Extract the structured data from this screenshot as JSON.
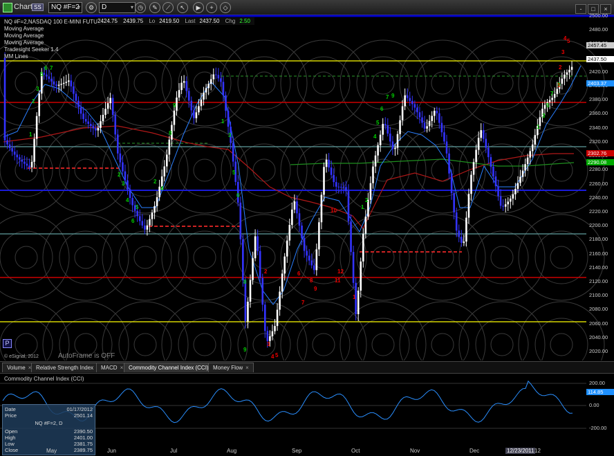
{
  "window": {
    "title": "Chart",
    "badge": "SS",
    "symbol_input": "NQ #F=2",
    "interval_input": "D",
    "controls": [
      "-",
      "□",
      "×"
    ]
  },
  "quote": {
    "open": "2424.75",
    "high": "2439.75",
    "lo_label": "Lo",
    "low": "2419.50",
    "last_label": "Last",
    "last": "2437.50",
    "chg_label": "Chg",
    "chg": "2.50"
  },
  "studies": {
    "header": "NQ #F=2,NASDAQ 100 E-MINI FUTURES",
    "items": [
      "Moving Average",
      "Moving Average",
      "Moving Average",
      "Tradesight Seeker 1.4",
      "MM Lines"
    ]
  },
  "watermark": {
    "esignal": "© eSignal, 2012",
    "autoframe": "AutoFrame is OFF",
    "p_button": "P"
  },
  "price_axis": {
    "ticks": [
      "2500.00",
      "2480.00",
      "2460.00",
      "2440.00",
      "2420.00",
      "2400.00",
      "2380.00",
      "2360.00",
      "2340.00",
      "2320.00",
      "2300.00",
      "2280.00",
      "2260.00",
      "2240.00",
      "2220.00",
      "2200.00",
      "2180.00",
      "2160.00",
      "2140.00",
      "2120.00",
      "2100.00",
      "2080.00",
      "2060.00",
      "2040.00",
      "2020.00"
    ],
    "tags": [
      {
        "text": "2457.45",
        "bg": "#cccccc",
        "fg": "#000000"
      },
      {
        "text": "2437.50",
        "bg": "#ffffff",
        "fg": "#000000"
      },
      {
        "text": "2403.37",
        "bg": "#1e90ff",
        "fg": "#ffffff"
      },
      {
        "text": "2302.76",
        "bg": "#cc0000",
        "fg": "#ffffff"
      },
      {
        "text": "2290.08",
        "bg": "#00aa00",
        "fg": "#ffffff"
      }
    ]
  },
  "tabs": [
    {
      "label": "Volume"
    },
    {
      "label": "Relative Strength Index"
    },
    {
      "label": "MACD"
    },
    {
      "label": "Commodity Channel Index (CCI)"
    },
    {
      "label": "Money Flow"
    }
  ],
  "cci": {
    "title": "Commodity Channel Index (CCI)",
    "ticks": [
      "200.00",
      "0.00",
      "-200.00"
    ],
    "tag": "114.85"
  },
  "data_popup": {
    "date_label": "Date",
    "date": "01/17/2012",
    "price_label": "Price",
    "price": "2501.14",
    "symbol": "NQ #F=2, D",
    "open_label": "Open",
    "open": "2390.50",
    "high_label": "High",
    "high": "2401.00",
    "low_label": "Low",
    "low": "2381.75",
    "close_label": "Close",
    "close": "2389.75"
  },
  "time_axis": [
    "May",
    "Jun",
    "Jul",
    "Aug",
    "Sep",
    "Oct",
    "Nov",
    "Dec",
    "12/23/2011",
    "12"
  ],
  "colors": {
    "up": "#ffffff",
    "down": "#3333ff",
    "red_line": "#cc0000",
    "yellow_line": "#ffff00",
    "blue_line": "#0000cc",
    "teal_line": "#5f9e9e"
  }
}
